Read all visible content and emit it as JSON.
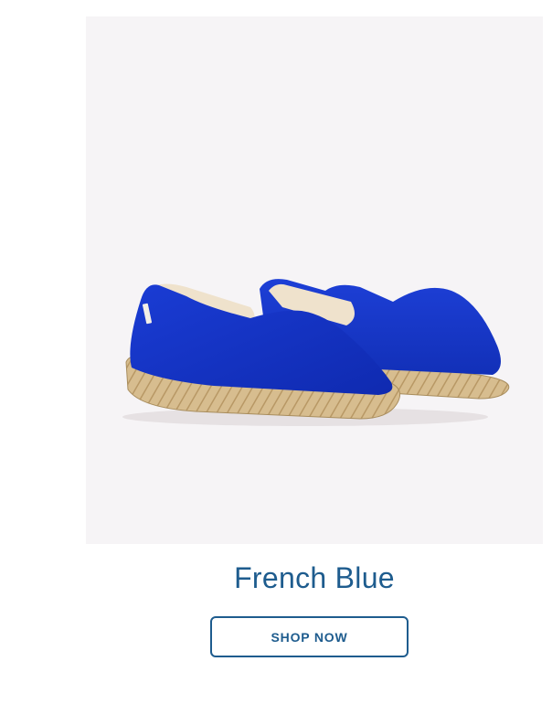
{
  "product": {
    "image_alt": "French Blue espadrilles",
    "title": "French Blue",
    "shop_button_label": "SHOP NOW"
  },
  "colors": {
    "title": "#1e5c8e",
    "button_border": "#1e5c8e",
    "image_background": "#f6f4f6",
    "shoe_canvas": "#1436c8",
    "jute_sole": "#d4b88a"
  }
}
